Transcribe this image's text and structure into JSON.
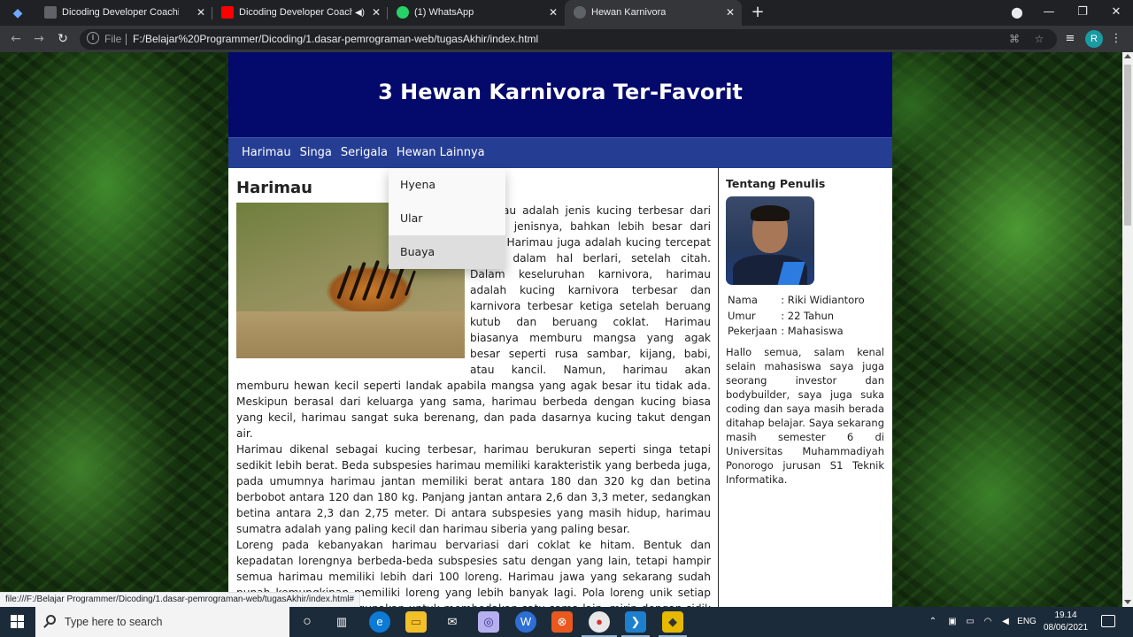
{
  "browser": {
    "tabs": [
      {
        "label": "Dicoding Developer Coaching #",
        "favicon_color": "#3b3b3b",
        "active": false
      },
      {
        "label": "Dicoding Developer Coachin",
        "favicon_color": "#ff0000",
        "active": false
      },
      {
        "label": "(1) WhatsApp",
        "favicon_color": "#25d366",
        "active": false
      },
      {
        "label": "Hewan Karnivora",
        "favicon_color": "#5f6368",
        "active": true
      }
    ],
    "address": {
      "protocol_label": "File",
      "url": "F:/Belajar%20Programmer/Dicoding/1.dasar-pemrograman-web/tugasAkhir/index.html"
    },
    "profile_initial": "R",
    "status_url": "file:///F:/Belajar Programmer/Dicoding/1.dasar-pemrograman-web/tugasAkhir/index.html#"
  },
  "site": {
    "title": "3 Hewan Karnivora Ter-Favorit",
    "nav": [
      "Harimau",
      "Singa",
      "Serigala",
      "Hewan Lainnya"
    ],
    "dropdown": [
      "Hyena",
      "Ular",
      "Buaya"
    ],
    "article": {
      "heading": "Harimau",
      "paragraphs": [
        "Harimau adalah jenis kucing terbesar dari semua jenisnya, bahkan lebih besar dari singa. Harimau juga adalah kucing tercepat kedua dalam hal berlari, setelah citah. Dalam keseluruhan karnivora, harimau adalah kucing karnivora terbesar dan karnivora terbesar ketiga setelah beruang kutub dan beruang coklat. Harimau biasanya memburu mangsa yang agak besar seperti rusa sambar, kijang, babi, atau kancil. Namun, harimau akan memburu hewan kecil seperti landak apabila mangsa yang agak besar itu tidak ada. Meskipun berasal dari keluarga yang sama, harimau berbeda dengan kucing biasa yang kecil, harimau sangat suka berenang, dan pada dasarnya kucing takut dengan air.",
        "Harimau dikenal sebagai kucing terbesar, harimau berukuran seperti singa tetapi sedikit lebih berat. Beda subspesies harimau memiliki karakteristik yang berbeda juga, pada umumnya harimau jantan memiliki berat antara 180 dan 320 kg dan betina berbobot antara 120 dan 180 kg. Panjang jantan antara 2,6 dan 3,3 meter, sedangkan betina antara 2,3 dan 2,75 meter. Di antara subspesies yang masih hidup, harimau sumatra adalah yang paling kecil dan harimau siberia yang paling besar.",
        "Loreng pada kebanyakan harimau bervariasi dari coklat ke hitam. Bentuk dan kepadatan lorengnya berbeda-beda subspesies satu dengan yang lain, tetapi hampir semua harimau memiliki lebih dari 100 loreng. Harimau jawa yang sekarang sudah punah kemungkinan memiliki loreng yang lebih banyak lagi. Pola loreng unik setiap harimau, dan dapat digunakan untuk membedakan satu sama lain, mirip dengan sidik jari yang digunakan untuk mengidentifikasi orang. Ini bukan"
      ]
    },
    "aside": {
      "heading": "Tentang Penulis",
      "bio_rows": [
        {
          "key": "Nama",
          "value": ": Riki Widiantoro"
        },
        {
          "key": "Umur",
          "value": ": 22 Tahun"
        },
        {
          "key": "Pekerjaan",
          "value": ": Mahasiswa"
        }
      ],
      "bio_text": "Hallo semua, salam kenal selain mahasiswa saya juga seorang investor dan bodybuilder, saya juga suka coding dan saya masih berada ditahap belajar. Saya sekarang masih semester 6 di Universitas Muhammadiyah Ponorogo jurusan S1 Teknik Informatika."
    }
  },
  "taskbar": {
    "search_placeholder": "Type here to search",
    "language": "ENG",
    "time": "19.14",
    "date": "08/06/2021"
  },
  "colors": {
    "header_bg": "#030a6b",
    "nav_bg": "#253e94",
    "dropdown_hover": "#dedede"
  }
}
